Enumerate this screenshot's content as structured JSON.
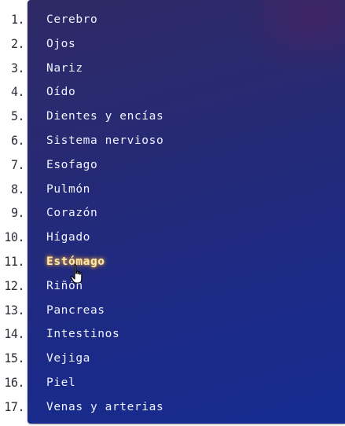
{
  "list": {
    "numbers": [
      "1.",
      "2.",
      "3.",
      "4.",
      "5.",
      "6.",
      "7.",
      "8.",
      "9.",
      "10.",
      "11.",
      "12.",
      "13.",
      "14.",
      "15.",
      "16.",
      "17."
    ],
    "items": [
      "Cerebro",
      "Ojos",
      "Nariz",
      "Oído",
      "Dientes y encías",
      "Sistema nervioso",
      "Esofago",
      "Pulmón",
      "Corazón",
      "Hígado",
      "Estómago",
      "Riñón",
      "Pancreas",
      "Intestinos",
      "Vejiga",
      "Piel",
      "Venas y arterias"
    ],
    "selected_index": 10
  },
  "colors": {
    "panel_gradient_start": "#2f2a66",
    "panel_gradient_end": "#152c90",
    "item_text": "#f1f3ff",
    "highlight_glow": "#ffbe3c",
    "number_text": "#2e2e3a"
  },
  "cursor": {
    "icon": "hand-pointer-icon"
  }
}
